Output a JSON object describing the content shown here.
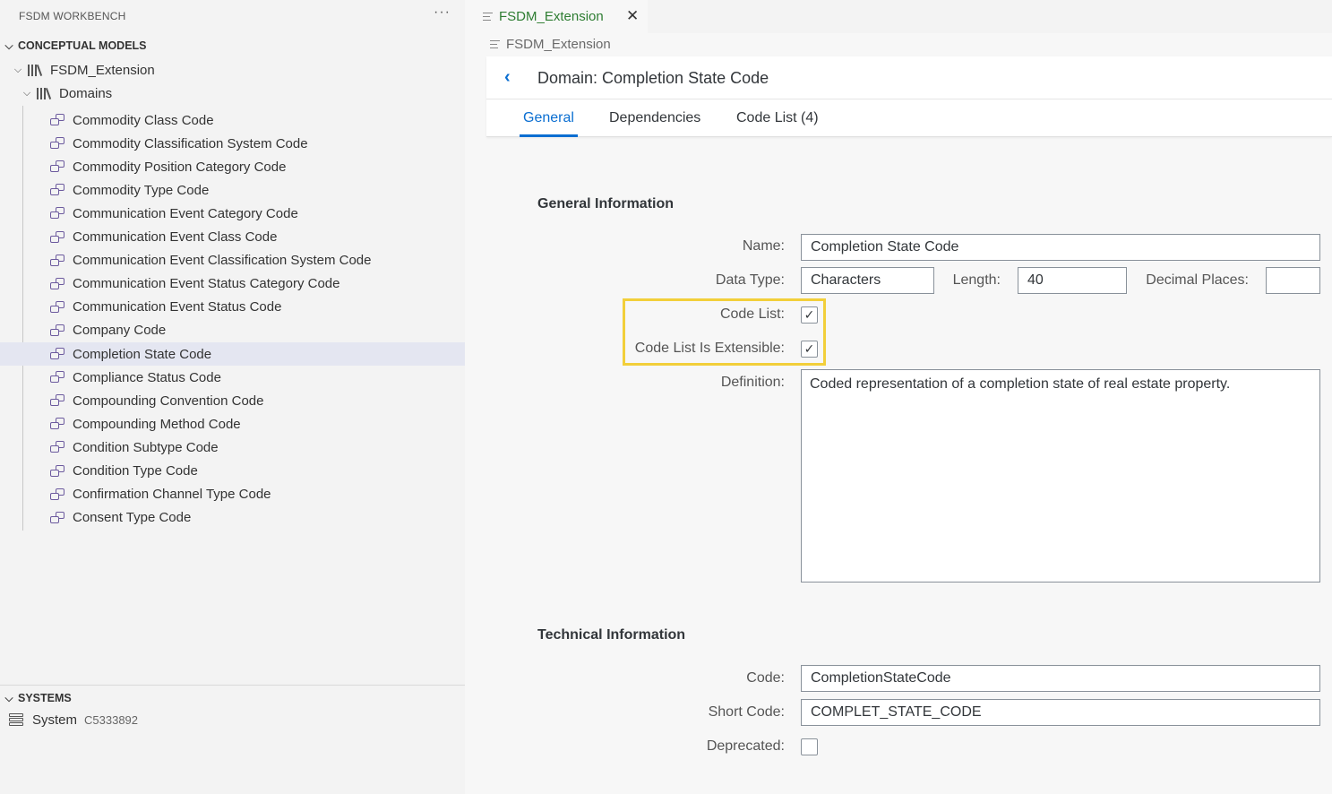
{
  "sidebar": {
    "header": "FSDM WORKBENCH",
    "more": "···",
    "section_models": "CONCEPTUAL MODELS",
    "model_name": "FSDM_Extension",
    "folder_name": "Domains",
    "items": [
      "Commodity Class Code",
      "Commodity Classification System Code",
      "Commodity Position Category Code",
      "Commodity Type Code",
      "Communication Event Category Code",
      "Communication Event Class Code",
      "Communication Event Classification System Code",
      "Communication Event Status Category Code",
      "Communication Event Status Code",
      "Company Code",
      "Completion State Code",
      "Compliance Status Code",
      "Compounding Convention Code",
      "Compounding Method Code",
      "Condition Subtype Code",
      "Condition Type Code",
      "Confirmation Channel Type Code",
      "Consent Type Code"
    ],
    "selected_item": "Completion State Code",
    "section_systems": "SYSTEMS",
    "system_label": "System",
    "system_id": "C5333892"
  },
  "editor": {
    "tab_label": "FSDM_Extension",
    "tab_close": "✕",
    "breadcrumb": "FSDM_Extension",
    "page_title": "Domain: Completion State Code",
    "tabs": [
      "General",
      "Dependencies",
      "Code List (4)"
    ],
    "active_tab": "General",
    "general": {
      "title": "General Information",
      "name_label": "Name:",
      "name_value": "Completion State Code",
      "datatype_label": "Data Type:",
      "datatype_value": "Characters",
      "length_label": "Length:",
      "length_value": "40",
      "decimal_label": "Decimal Places:",
      "decimal_value": "",
      "codelist_label": "Code List:",
      "codelist_checked": true,
      "extensible_label": "Code List Is Extensible:",
      "extensible_checked": true,
      "definition_label": "Definition:",
      "definition_value": "Coded representation of a completion state of real estate property."
    },
    "technical": {
      "title": "Technical Information",
      "code_label": "Code:",
      "code_value": "CompletionStateCode",
      "shortcode_label": "Short Code:",
      "shortcode_value": "COMPLET_STATE_CODE",
      "deprecated_label": "Deprecated:",
      "deprecated_checked": false
    }
  },
  "colors": {
    "accent": "#0a6ed1",
    "highlight": "#f2cf3a",
    "tab_text": "#2e7d32",
    "domain_icon": "#6c5a9e",
    "selection": "#e4e6f1"
  }
}
